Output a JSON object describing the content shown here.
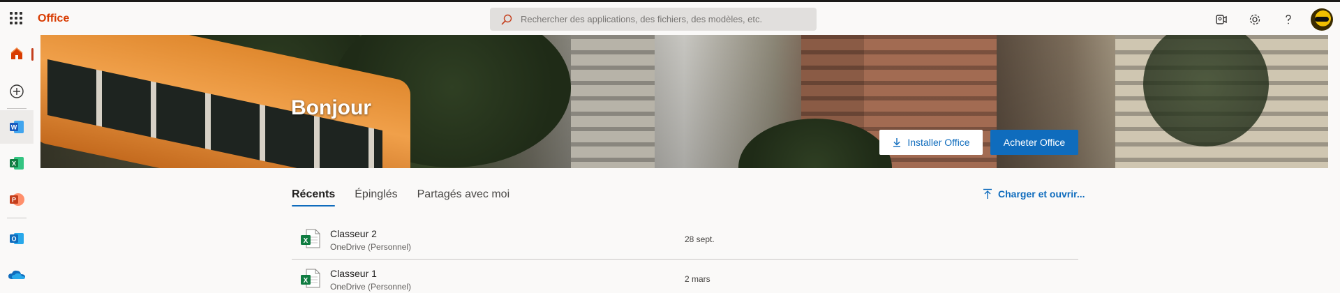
{
  "header": {
    "brand": "Office",
    "search_placeholder": "Rechercher des applications, des fichiers, des modèles, etc.",
    "icons": [
      "waffle-icon",
      "search-icon",
      "meet-now-icon",
      "settings-gear-icon",
      "help-icon",
      "avatar"
    ]
  },
  "siderail": {
    "items": [
      {
        "name": "home",
        "icon": "home-icon",
        "active": true
      },
      {
        "name": "create",
        "icon": "plus-circle-icon"
      },
      {
        "name": "word",
        "icon": "word-icon"
      },
      {
        "name": "excel",
        "icon": "excel-icon"
      },
      {
        "name": "powerpoint",
        "icon": "powerpoint-icon"
      },
      {
        "name": "outlook",
        "icon": "outlook-icon"
      },
      {
        "name": "onedrive",
        "icon": "onedrive-icon"
      }
    ]
  },
  "hero": {
    "greeting": "Bonjour",
    "install_label": "Installer Office",
    "buy_label": "Acheter Office"
  },
  "tabs": [
    {
      "label": "Récents",
      "active": true
    },
    {
      "label": "Épinglés"
    },
    {
      "label": "Partagés avec moi"
    }
  ],
  "upload_label": "Charger et ouvrir...",
  "files": [
    {
      "name": "Classeur 2",
      "location": "OneDrive (Personnel)",
      "date": "28 sept.",
      "icon": "excel-file-icon"
    },
    {
      "name": "Classeur 1",
      "location": "OneDrive (Personnel)",
      "date": "2 mars",
      "icon": "excel-file-icon"
    }
  ],
  "colors": {
    "brand": "#d83b01",
    "accent": "#0f6cbd",
    "excel": "#107c41",
    "word": "#185abd",
    "powerpoint": "#c43e1c",
    "outlook": "#0f6cbd"
  }
}
